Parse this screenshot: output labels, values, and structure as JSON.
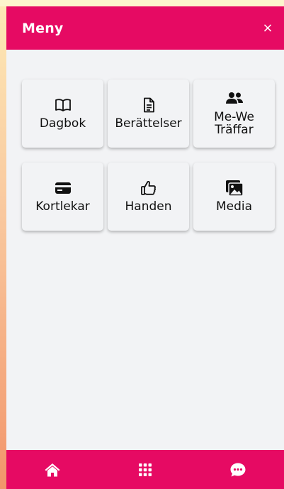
{
  "header": {
    "title": "Meny",
    "close_label": "×"
  },
  "menu": {
    "items": [
      {
        "label": "Dagbok",
        "icon": "book-open-icon"
      },
      {
        "label": "Berättelser",
        "icon": "document-icon"
      },
      {
        "label": "Me-We\nTräffar",
        "icon": "users-icon"
      },
      {
        "label": "Kortlekar",
        "icon": "credit-card-icon"
      },
      {
        "label": "Handen",
        "icon": "thumbs-up-icon"
      },
      {
        "label": "Media",
        "icon": "images-icon"
      }
    ]
  },
  "footer": {
    "items": [
      "home-icon",
      "grid-icon",
      "chat-icon"
    ]
  },
  "colors": {
    "accent": "#e60a63",
    "panel": "#f2f3f5"
  }
}
